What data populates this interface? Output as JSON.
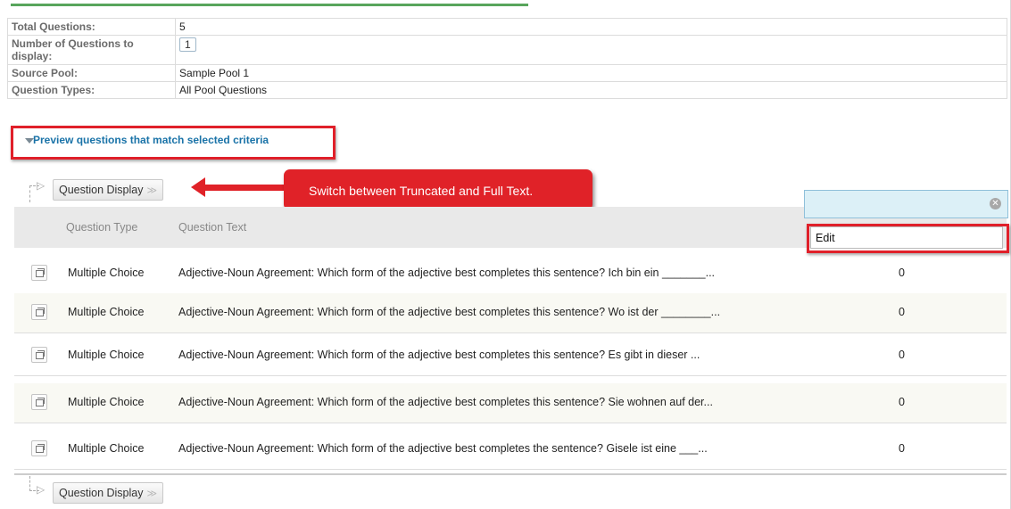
{
  "info": {
    "rows": [
      {
        "label": "Total Questions:",
        "value": "5"
      },
      {
        "label": "Number of Questions to display:",
        "value": "1"
      },
      {
        "label": "Source Pool:",
        "value": "Sample Pool 1"
      },
      {
        "label": "Question Types:",
        "value": "All Pool Questions"
      }
    ]
  },
  "preview": {
    "label": "Preview questions that match selected criteria"
  },
  "toolbar": {
    "question_display_label": "Question Display"
  },
  "callout": {
    "text": "Switch between Truncated and Full Text."
  },
  "table": {
    "headers": {
      "type": "Question Type",
      "text": "Question Text"
    },
    "rows": [
      {
        "type": "Multiple Choice",
        "text": "Adjective-Noun Agreement: Which form of the adjective best completes this sentence? Ich bin ein _______...",
        "count": "0"
      },
      {
        "type": "Multiple Choice",
        "text": "Adjective-Noun Agreement: Which form of the adjective best completes this sentence? Wo ist der ________...",
        "count": "0"
      },
      {
        "type": "Multiple Choice",
        "text": "Adjective-Noun Agreement: Which form of the adjective best completes this sentence? Es gibt in dieser ...",
        "count": "0"
      },
      {
        "type": "Multiple Choice",
        "text": "Adjective-Noun Agreement: Which form of the adjective best completes this sentence? Sie wohnen auf der...",
        "count": "0"
      },
      {
        "type": "Multiple Choice",
        "text": "Adjective-Noun Agreement: Which form of the adjective best completes the sentence? Gisele ist eine ___...",
        "count": "0"
      }
    ]
  },
  "popup": {
    "menu_item": "Edit"
  },
  "icons": {
    "row_icon": "preview-window-icon",
    "chevron": "double-chevron-down-icon",
    "clear": "clear-circle-icon"
  },
  "colors": {
    "highlight": "#e0202a",
    "link": "#1a73a8",
    "popup_bg": "#dcf0f7"
  }
}
